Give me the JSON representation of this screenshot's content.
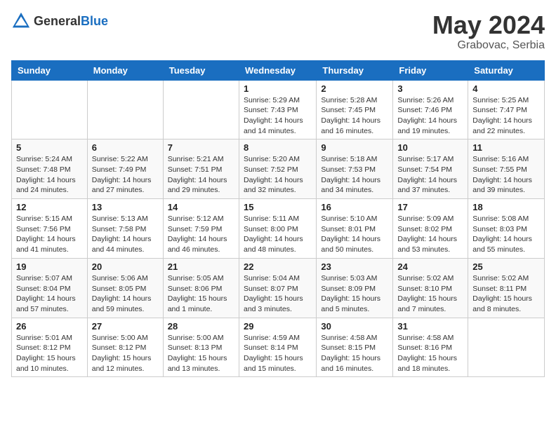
{
  "header": {
    "logo_general": "General",
    "logo_blue": "Blue",
    "month": "May 2024",
    "location": "Grabovac, Serbia"
  },
  "days_of_week": [
    "Sunday",
    "Monday",
    "Tuesday",
    "Wednesday",
    "Thursday",
    "Friday",
    "Saturday"
  ],
  "weeks": [
    [
      {
        "day": "",
        "info": ""
      },
      {
        "day": "",
        "info": ""
      },
      {
        "day": "",
        "info": ""
      },
      {
        "day": "1",
        "info": "Sunrise: 5:29 AM\nSunset: 7:43 PM\nDaylight: 14 hours\nand 14 minutes."
      },
      {
        "day": "2",
        "info": "Sunrise: 5:28 AM\nSunset: 7:45 PM\nDaylight: 14 hours\nand 16 minutes."
      },
      {
        "day": "3",
        "info": "Sunrise: 5:26 AM\nSunset: 7:46 PM\nDaylight: 14 hours\nand 19 minutes."
      },
      {
        "day": "4",
        "info": "Sunrise: 5:25 AM\nSunset: 7:47 PM\nDaylight: 14 hours\nand 22 minutes."
      }
    ],
    [
      {
        "day": "5",
        "info": "Sunrise: 5:24 AM\nSunset: 7:48 PM\nDaylight: 14 hours\nand 24 minutes."
      },
      {
        "day": "6",
        "info": "Sunrise: 5:22 AM\nSunset: 7:49 PM\nDaylight: 14 hours\nand 27 minutes."
      },
      {
        "day": "7",
        "info": "Sunrise: 5:21 AM\nSunset: 7:51 PM\nDaylight: 14 hours\nand 29 minutes."
      },
      {
        "day": "8",
        "info": "Sunrise: 5:20 AM\nSunset: 7:52 PM\nDaylight: 14 hours\nand 32 minutes."
      },
      {
        "day": "9",
        "info": "Sunrise: 5:18 AM\nSunset: 7:53 PM\nDaylight: 14 hours\nand 34 minutes."
      },
      {
        "day": "10",
        "info": "Sunrise: 5:17 AM\nSunset: 7:54 PM\nDaylight: 14 hours\nand 37 minutes."
      },
      {
        "day": "11",
        "info": "Sunrise: 5:16 AM\nSunset: 7:55 PM\nDaylight: 14 hours\nand 39 minutes."
      }
    ],
    [
      {
        "day": "12",
        "info": "Sunrise: 5:15 AM\nSunset: 7:56 PM\nDaylight: 14 hours\nand 41 minutes."
      },
      {
        "day": "13",
        "info": "Sunrise: 5:13 AM\nSunset: 7:58 PM\nDaylight: 14 hours\nand 44 minutes."
      },
      {
        "day": "14",
        "info": "Sunrise: 5:12 AM\nSunset: 7:59 PM\nDaylight: 14 hours\nand 46 minutes."
      },
      {
        "day": "15",
        "info": "Sunrise: 5:11 AM\nSunset: 8:00 PM\nDaylight: 14 hours\nand 48 minutes."
      },
      {
        "day": "16",
        "info": "Sunrise: 5:10 AM\nSunset: 8:01 PM\nDaylight: 14 hours\nand 50 minutes."
      },
      {
        "day": "17",
        "info": "Sunrise: 5:09 AM\nSunset: 8:02 PM\nDaylight: 14 hours\nand 53 minutes."
      },
      {
        "day": "18",
        "info": "Sunrise: 5:08 AM\nSunset: 8:03 PM\nDaylight: 14 hours\nand 55 minutes."
      }
    ],
    [
      {
        "day": "19",
        "info": "Sunrise: 5:07 AM\nSunset: 8:04 PM\nDaylight: 14 hours\nand 57 minutes."
      },
      {
        "day": "20",
        "info": "Sunrise: 5:06 AM\nSunset: 8:05 PM\nDaylight: 14 hours\nand 59 minutes."
      },
      {
        "day": "21",
        "info": "Sunrise: 5:05 AM\nSunset: 8:06 PM\nDaylight: 15 hours\nand 1 minute."
      },
      {
        "day": "22",
        "info": "Sunrise: 5:04 AM\nSunset: 8:07 PM\nDaylight: 15 hours\nand 3 minutes."
      },
      {
        "day": "23",
        "info": "Sunrise: 5:03 AM\nSunset: 8:09 PM\nDaylight: 15 hours\nand 5 minutes."
      },
      {
        "day": "24",
        "info": "Sunrise: 5:02 AM\nSunset: 8:10 PM\nDaylight: 15 hours\nand 7 minutes."
      },
      {
        "day": "25",
        "info": "Sunrise: 5:02 AM\nSunset: 8:11 PM\nDaylight: 15 hours\nand 8 minutes."
      }
    ],
    [
      {
        "day": "26",
        "info": "Sunrise: 5:01 AM\nSunset: 8:12 PM\nDaylight: 15 hours\nand 10 minutes."
      },
      {
        "day": "27",
        "info": "Sunrise: 5:00 AM\nSunset: 8:12 PM\nDaylight: 15 hours\nand 12 minutes."
      },
      {
        "day": "28",
        "info": "Sunrise: 5:00 AM\nSunset: 8:13 PM\nDaylight: 15 hours\nand 13 minutes."
      },
      {
        "day": "29",
        "info": "Sunrise: 4:59 AM\nSunset: 8:14 PM\nDaylight: 15 hours\nand 15 minutes."
      },
      {
        "day": "30",
        "info": "Sunrise: 4:58 AM\nSunset: 8:15 PM\nDaylight: 15 hours\nand 16 minutes."
      },
      {
        "day": "31",
        "info": "Sunrise: 4:58 AM\nSunset: 8:16 PM\nDaylight: 15 hours\nand 18 minutes."
      },
      {
        "day": "",
        "info": ""
      }
    ]
  ]
}
